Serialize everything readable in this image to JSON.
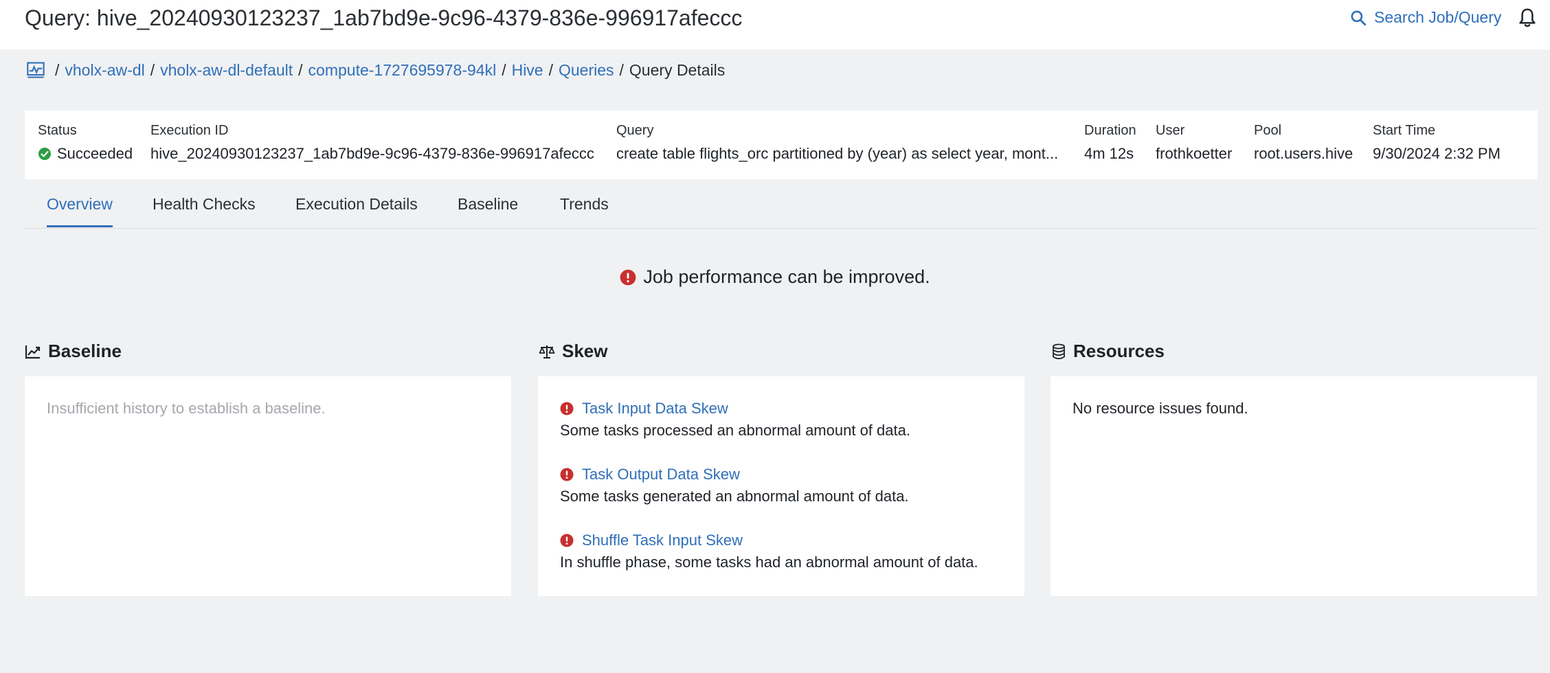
{
  "header": {
    "title": "Query: hive_20240930123237_1ab7bd9e-9c96-4379-836e-996917afeccc",
    "search_label": "Search Job/Query",
    "accent_color": "#2f6fb8"
  },
  "breadcrumb": {
    "items": [
      "vholx-aw-dl",
      "vholx-aw-dl-default",
      "compute-1727695978-94kl",
      "Hive",
      "Queries"
    ],
    "current": "Query Details"
  },
  "summary": {
    "status_label": "Status",
    "status_value": "Succeeded",
    "status_color": "#2e9e44",
    "execution_id_label": "Execution ID",
    "execution_id_value": "hive_20240930123237_1ab7bd9e-9c96-4379-836e-996917afeccc",
    "query_label": "Query",
    "query_value": "create table flights_orc partitioned by (year) as select year, mont...",
    "duration_label": "Duration",
    "duration_value": "4m 12s",
    "user_label": "User",
    "user_value": "frothkoetter",
    "pool_label": "Pool",
    "pool_value": "root.users.hive",
    "start_time_label": "Start Time",
    "start_time_value": "9/30/2024 2:32 PM"
  },
  "tabs": [
    {
      "label": "Overview",
      "active": true
    },
    {
      "label": "Health Checks",
      "active": false
    },
    {
      "label": "Execution Details",
      "active": false
    },
    {
      "label": "Baseline",
      "active": false
    },
    {
      "label": "Trends",
      "active": false
    }
  ],
  "performance_message": "Job performance can be improved.",
  "error_color": "#c8302f",
  "baseline": {
    "heading": "Baseline",
    "message": "Insufficient history to establish a baseline."
  },
  "skew": {
    "heading": "Skew",
    "items": [
      {
        "title": "Task Input Data Skew",
        "description": "Some tasks processed an abnormal amount of data."
      },
      {
        "title": "Task Output Data Skew",
        "description": "Some tasks generated an abnormal amount of data."
      },
      {
        "title": "Shuffle Task Input Skew",
        "description": "In shuffle phase, some tasks had an abnormal amount of data."
      }
    ]
  },
  "resources": {
    "heading": "Resources",
    "message": "No resource issues found."
  }
}
